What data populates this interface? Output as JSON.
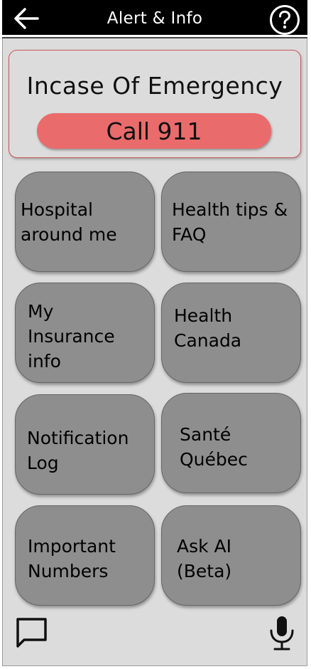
{
  "header": {
    "title": "Alert & Info",
    "back_icon": "arrow-left-icon",
    "help_icon": "question-circle-icon"
  },
  "emergency": {
    "title": "Incase Of Emergency",
    "call_label": "Call 911",
    "accent": "#ea6b6b"
  },
  "tiles": [
    {
      "label": "Hospital\naround me"
    },
    {
      "label": "Health tips &\nFAQ"
    },
    {
      "label": "My\nInsurance\ninfo"
    },
    {
      "label": "Health\nCanada"
    },
    {
      "label": "Notification\nLog"
    },
    {
      "label": "Santé\nQuébec"
    },
    {
      "label": "Important\nNumbers"
    },
    {
      "label": "Ask AI\n(Beta)"
    }
  ],
  "footer": {
    "chat_icon": "chat-bubble-icon",
    "mic_icon": "microphone-icon"
  }
}
